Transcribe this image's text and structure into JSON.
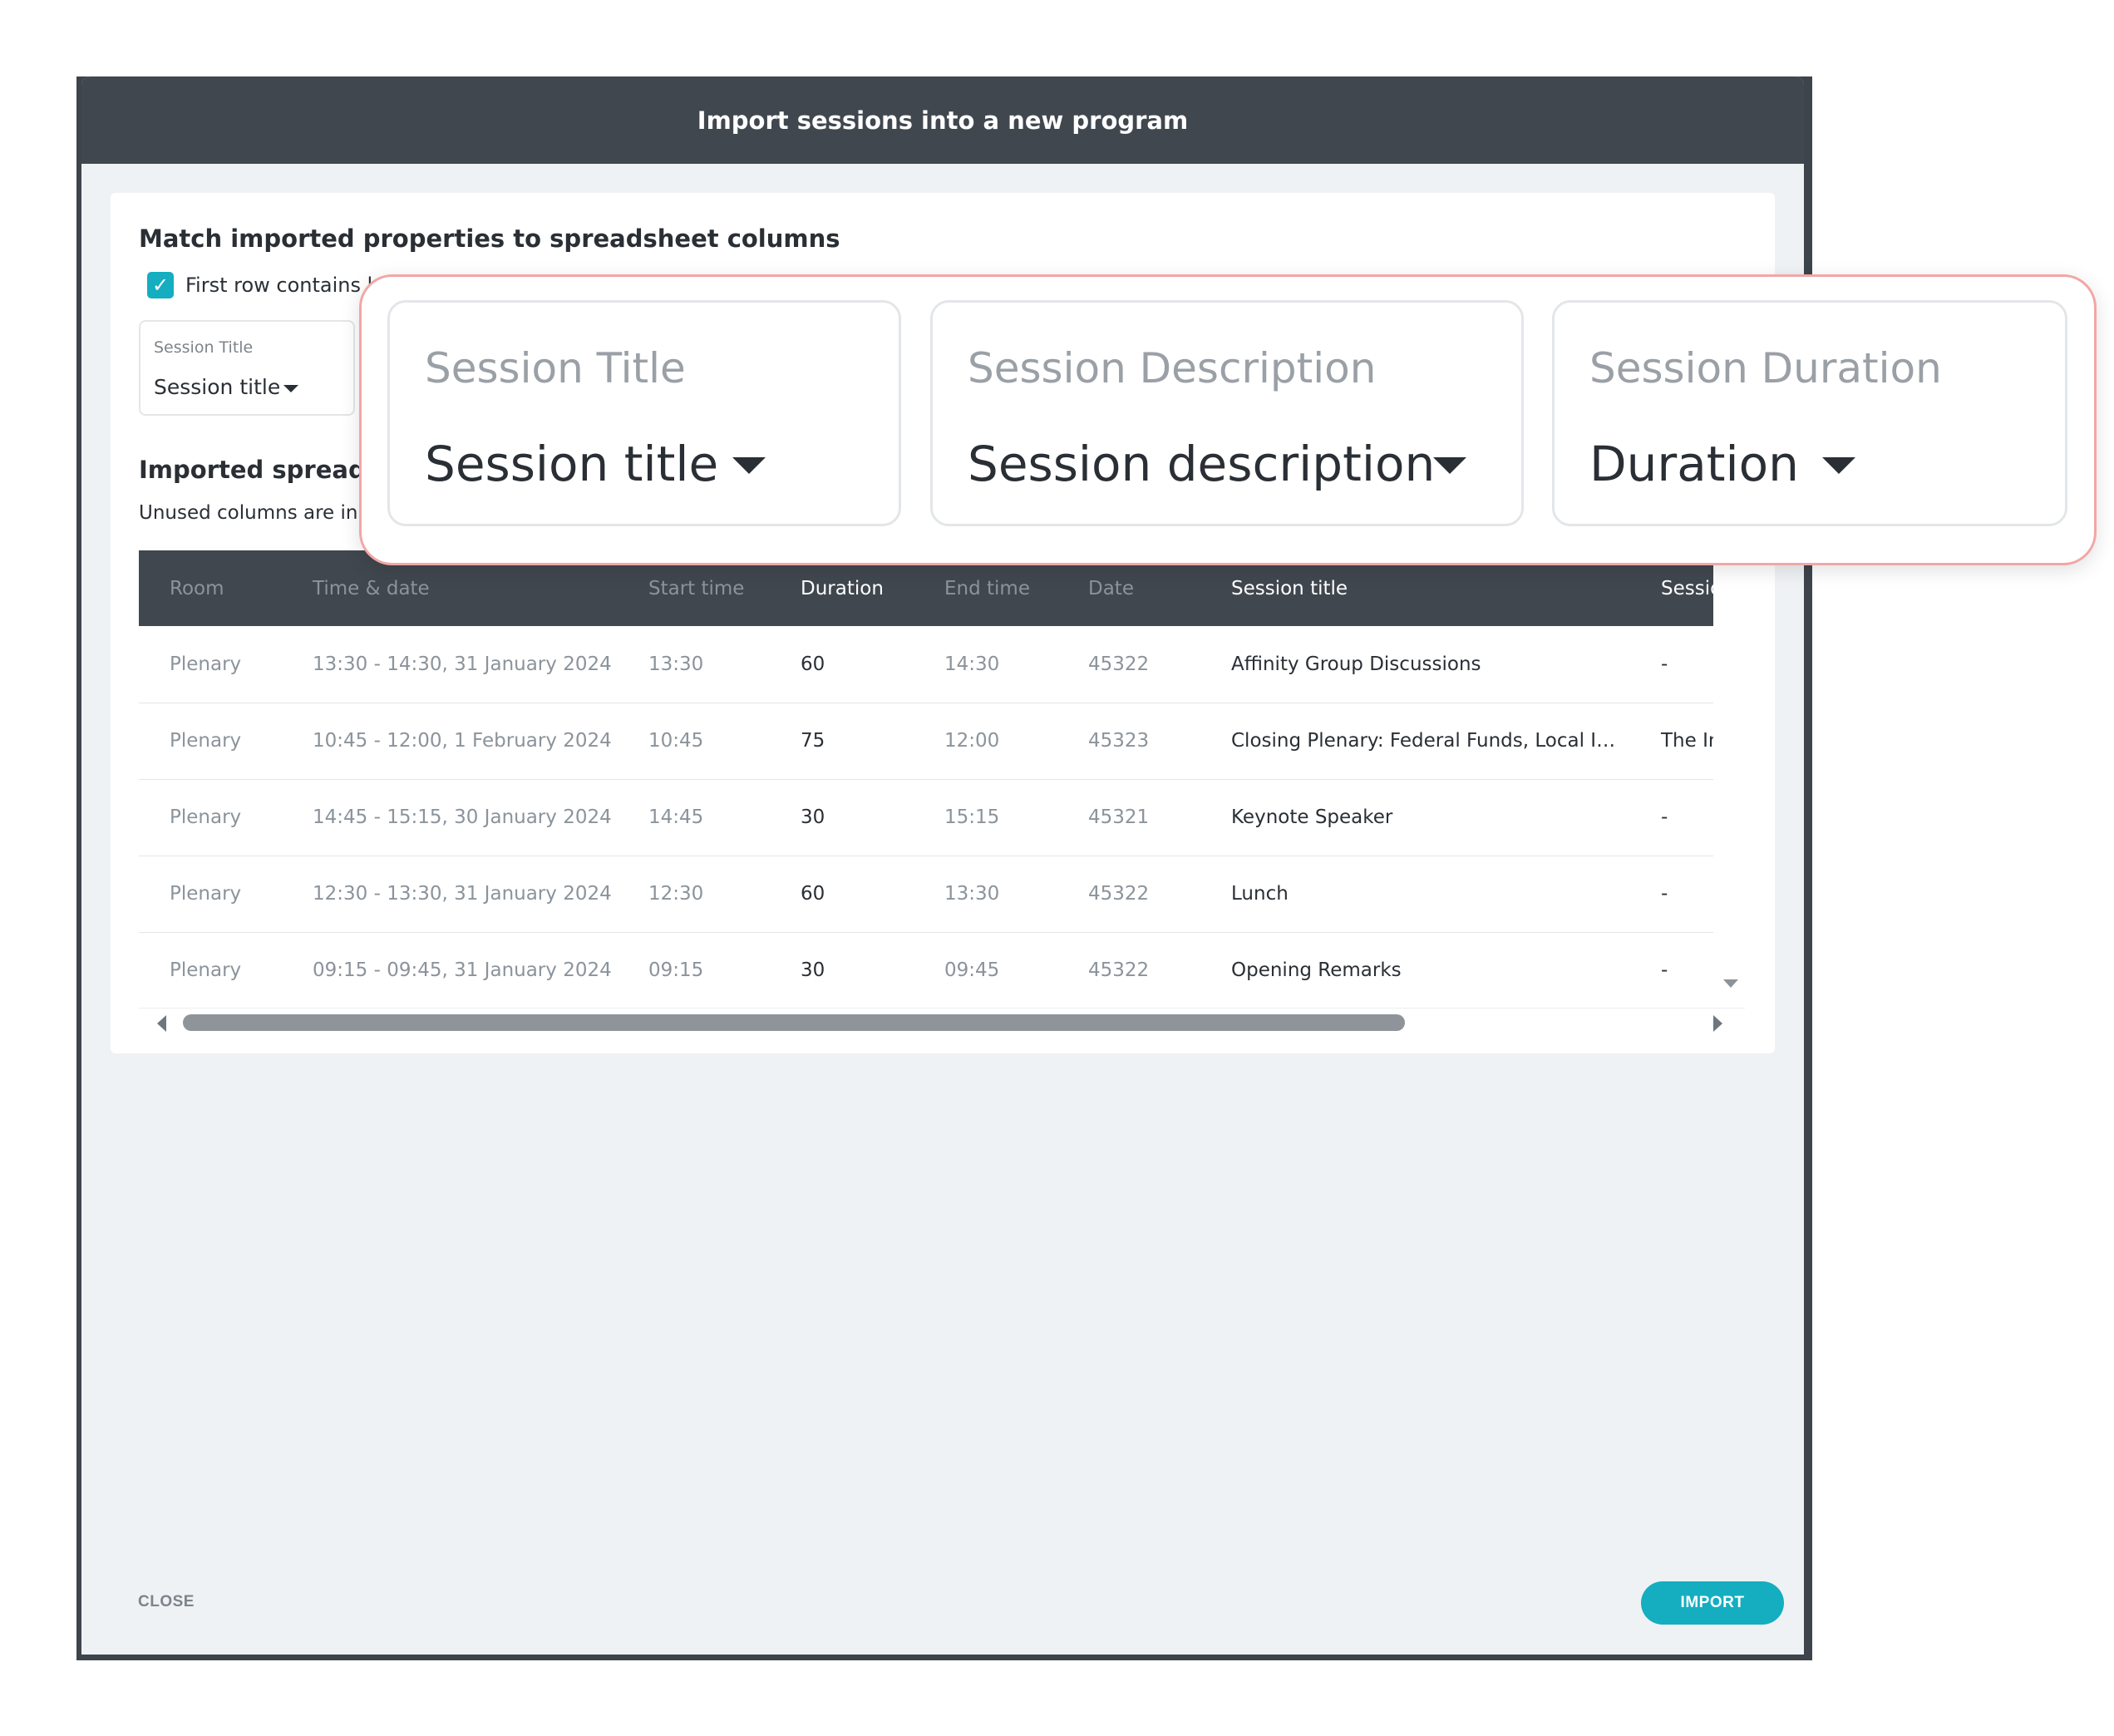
{
  "modal": {
    "title": "Import sessions into a new program",
    "close_label": "CLOSE",
    "import_label": "IMPORT"
  },
  "mapping": {
    "section_title": "Match imported properties to spreadsheet columns",
    "header_checkbox_label": "First row contains he",
    "header_checkbox_checked": true,
    "fields": [
      {
        "label": "Session Title",
        "value": "Session title"
      }
    ]
  },
  "zoom": {
    "fields": [
      {
        "label": "Session Title",
        "value": "Session title"
      },
      {
        "label": "Session Description",
        "value": "Session description"
      },
      {
        "label": "Session Duration",
        "value": "Duration"
      }
    ]
  },
  "spreadsheet": {
    "section_title": "Imported spreadshe",
    "subtitle": "Unused columns are in fa",
    "columns": [
      {
        "label": "Room",
        "used": false
      },
      {
        "label": "Time & date",
        "used": false
      },
      {
        "label": "Start time",
        "used": false
      },
      {
        "label": "Duration",
        "used": true
      },
      {
        "label": "End time",
        "used": false
      },
      {
        "label": "Date",
        "used": false
      },
      {
        "label": "Session title",
        "used": true
      },
      {
        "label": "Sessio",
        "used": true
      }
    ],
    "rows": [
      [
        "Plenary",
        "13:30 - 14:30, 31 January 2024",
        "13:30",
        "60",
        "14:30",
        "45322",
        "Affinity Group Discussions",
        "-"
      ],
      [
        "Plenary",
        "10:45 - 12:00, 1 February 2024",
        "10:45",
        "75",
        "12:00",
        "45323",
        "Closing Plenary: Federal Funds, Local I…",
        "The In"
      ],
      [
        "Plenary",
        "14:45 - 15:15, 30 January 2024",
        "14:45",
        "30",
        "15:15",
        "45321",
        "Keynote Speaker",
        "-"
      ],
      [
        "Plenary",
        "12:30 - 13:30, 31 January 2024",
        "12:30",
        "60",
        "13:30",
        "45322",
        "Lunch",
        "-"
      ],
      [
        "Plenary",
        "09:15 - 09:45, 31 January 2024",
        "09:15",
        "30",
        "09:45",
        "45322",
        "Opening Remarks",
        "-"
      ]
    ]
  },
  "colors": {
    "accent": "#14aec0",
    "header_dark": "#40474e",
    "callout_border": "#f2a6a6"
  }
}
